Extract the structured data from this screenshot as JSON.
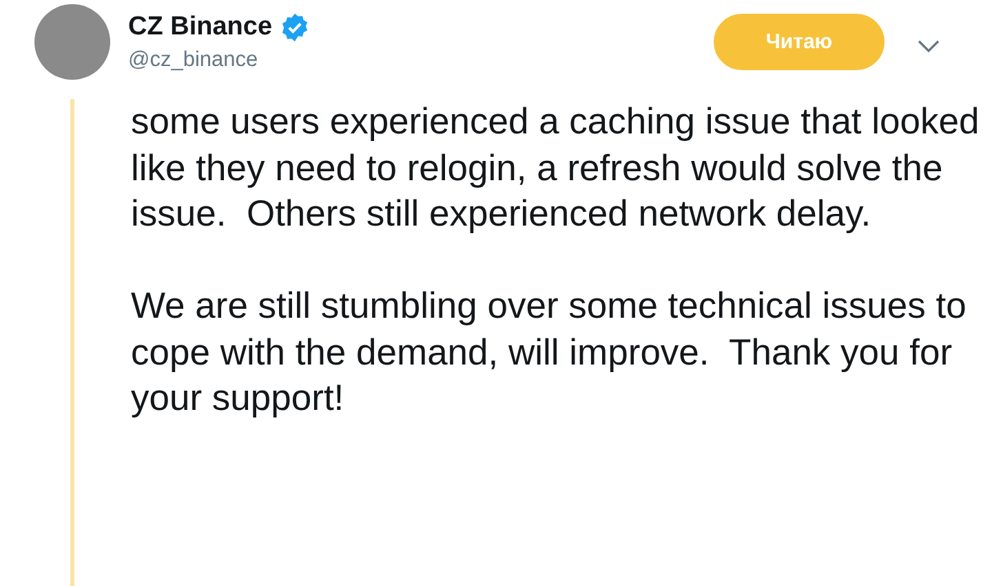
{
  "author": {
    "name": "CZ Binance",
    "verified": true,
    "handle": "@cz_binance"
  },
  "follow_button": {
    "label": "Читаю",
    "selected": true
  },
  "tweet": {
    "paragraphs": [
      "some users experienced a caching issue that looked like they need to relogin, a refresh would solve the issue.  Others still experienced network delay.",
      "We are still stumbling over some technical issues to cope with the demand, will improve.  Thank you for your support!"
    ]
  }
}
